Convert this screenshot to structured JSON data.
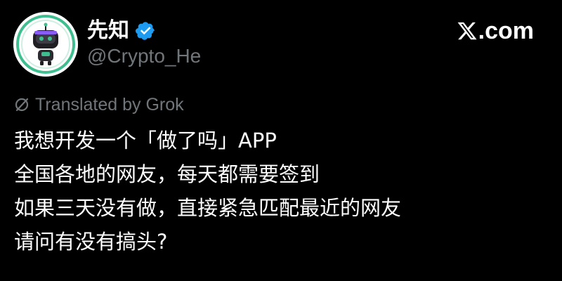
{
  "author": {
    "display_name": "先知",
    "handle": "@Crypto_He",
    "verified": true,
    "verified_color": "#1d9bf0"
  },
  "brand": {
    "text": ".com",
    "icon": "x-logo-icon"
  },
  "translation": {
    "label": "Translated by Grok",
    "icon": "grok-icon"
  },
  "post": {
    "lines": [
      "我想开发一个「做了吗」APP",
      "全国各地的网友，每天都需要签到",
      "如果三天没有做，直接紧急匹配最近的网友",
      "请问有没有搞头?"
    ]
  },
  "colors": {
    "background": "#000000",
    "text_primary": "#ffffff",
    "text_secondary": "#71767b",
    "avatar_accent": "#3fbf8f"
  }
}
